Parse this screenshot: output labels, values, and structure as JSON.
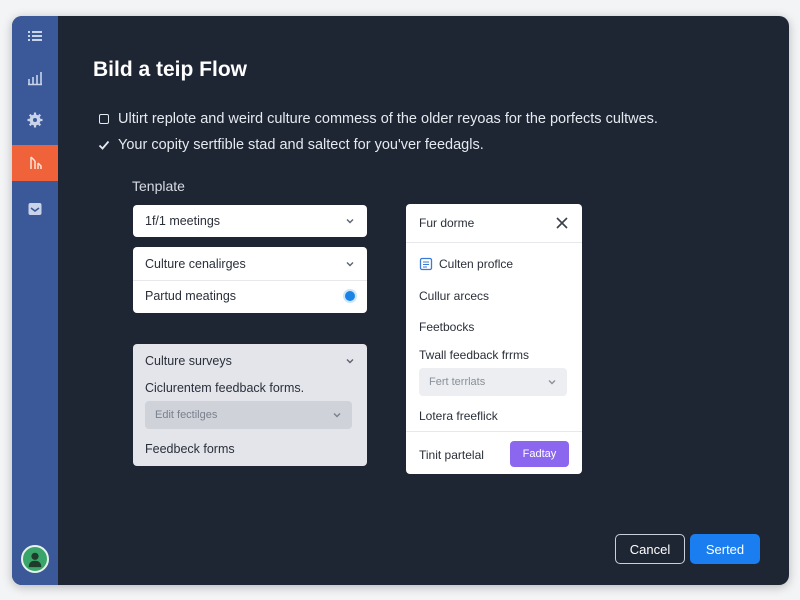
{
  "page": {
    "title": "Bild a teip Flow",
    "intro": [
      {
        "icon": "checkbox-empty-icon",
        "text": "Ultirt replote and weird culture commess of the older reyoas for the porfects cultwes."
      },
      {
        "icon": "checkmark-icon",
        "text": "Your copity sertfible stad and saltect for you'ver feedagls."
      }
    ],
    "section_label": "Tenplate"
  },
  "template_card": {
    "select_label": "1f/1 meetings"
  },
  "options_card": {
    "items": [
      {
        "label": "Culture cenalirges"
      },
      {
        "label": "Partud meatings"
      }
    ]
  },
  "culture_card": {
    "heading": "Culture surveys",
    "sub_label": "Ciclurentem feedback forms.",
    "select_placeholder": "Edit fectilges",
    "footer_label": "Feedbeck forms"
  },
  "panel": {
    "header": "Fur dorme",
    "item_profile": "Culten proflce",
    "item_access": "Cullur arcecs",
    "item_feedbacks": "Feetbocks",
    "item_forms": "Twall feedback frrms",
    "select_placeholder": "Fert terrlats",
    "item_loterfeedback": "Lotera freeflick",
    "footer_text": "Tinit partelal",
    "footer_button": "Fadtay"
  },
  "actions": {
    "cancel_label": "Cancel",
    "primary_label": "Serted"
  },
  "sidebar": {
    "icons": [
      "list-icon",
      "bar-chart-icon",
      "settings-gear-icon",
      "flow-icon",
      "inbox-icon"
    ],
    "active_index": 3
  },
  "colors": {
    "sidebar": "#3b5998",
    "active": "#f0633a",
    "primary": "#1a7df0",
    "panel_button": "#8b67f0",
    "background": "#1f2633"
  }
}
